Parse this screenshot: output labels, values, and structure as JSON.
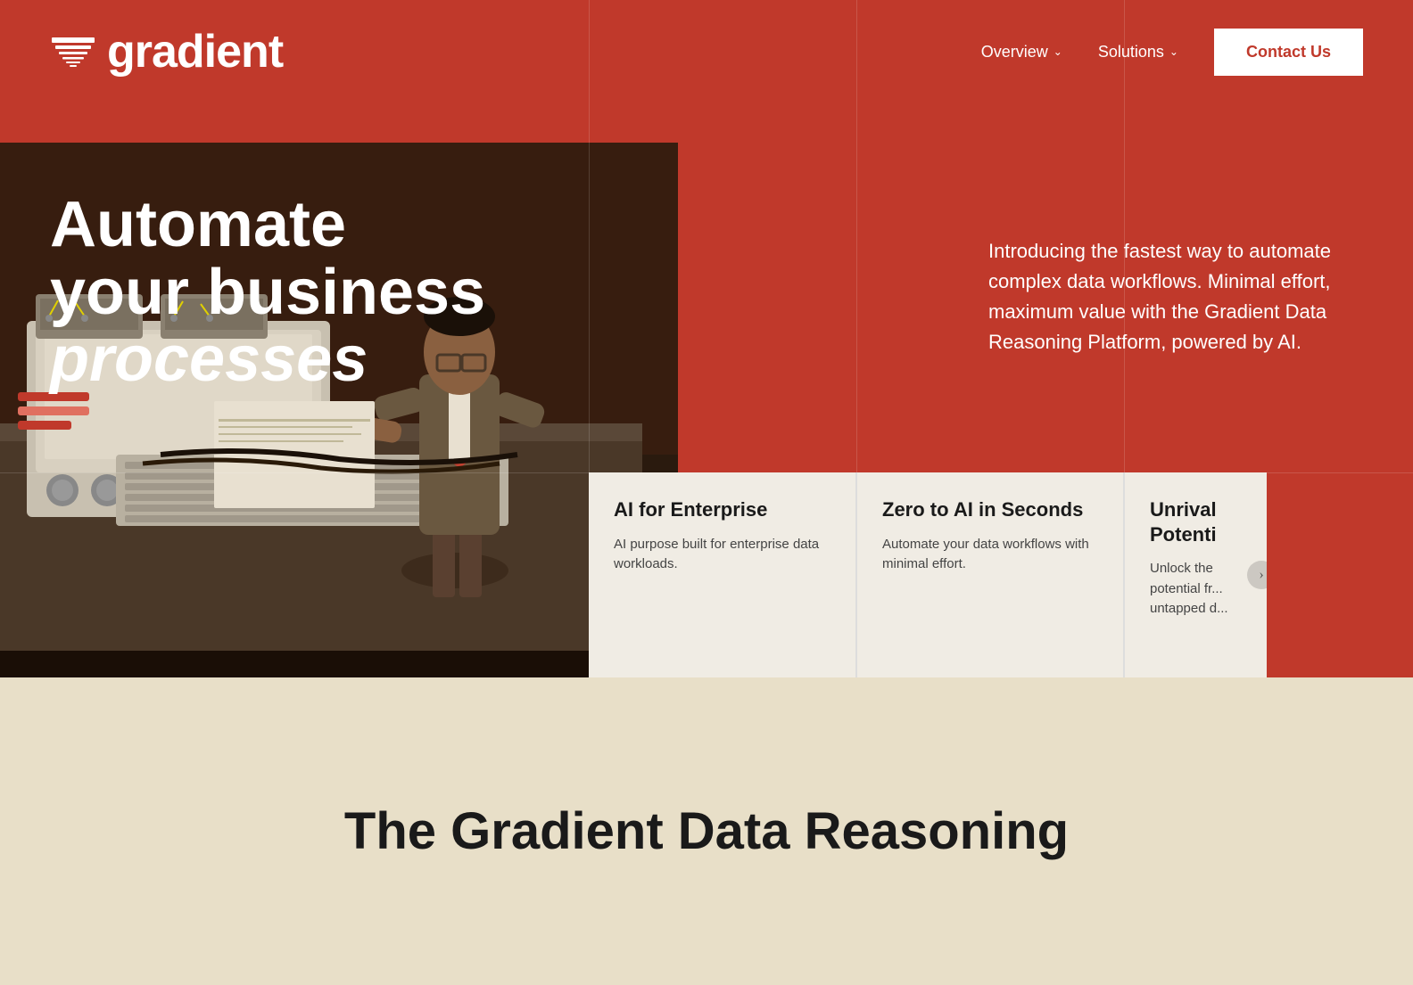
{
  "brand": {
    "logo_text": "gradient",
    "logo_icon_alt": "gradient-logo-icon"
  },
  "nav": {
    "overview_label": "Overview",
    "solutions_label": "Solutions",
    "contact_label": "Contact Us"
  },
  "hero": {
    "headline_line1": "Automate",
    "headline_line2": "your business",
    "headline_line3": "processes",
    "description": "Introducing the fastest way to automate complex data workflows. Minimal effort, maximum value with the Gradient Data Reasoning Platform, powered by AI."
  },
  "cards": [
    {
      "title": "AI for Enterprise",
      "description": "AI purpose built for enterprise data workloads."
    },
    {
      "title": "Zero to AI in Seconds",
      "description": "Automate your data workflows with minimal effort."
    },
    {
      "title": "Unrivaled Potential",
      "description": "Unlock the potential from untapped d..."
    }
  ],
  "bottom": {
    "title": "The Gradient Data Reasoning"
  },
  "colors": {
    "hero_bg": "#c0392b",
    "card_bg": "#f0ece4",
    "bottom_bg": "#e8dfc8",
    "text_white": "#ffffff",
    "text_dark": "#1a1a1a",
    "contact_btn_bg": "#ffffff",
    "contact_btn_color": "#c0392b"
  }
}
